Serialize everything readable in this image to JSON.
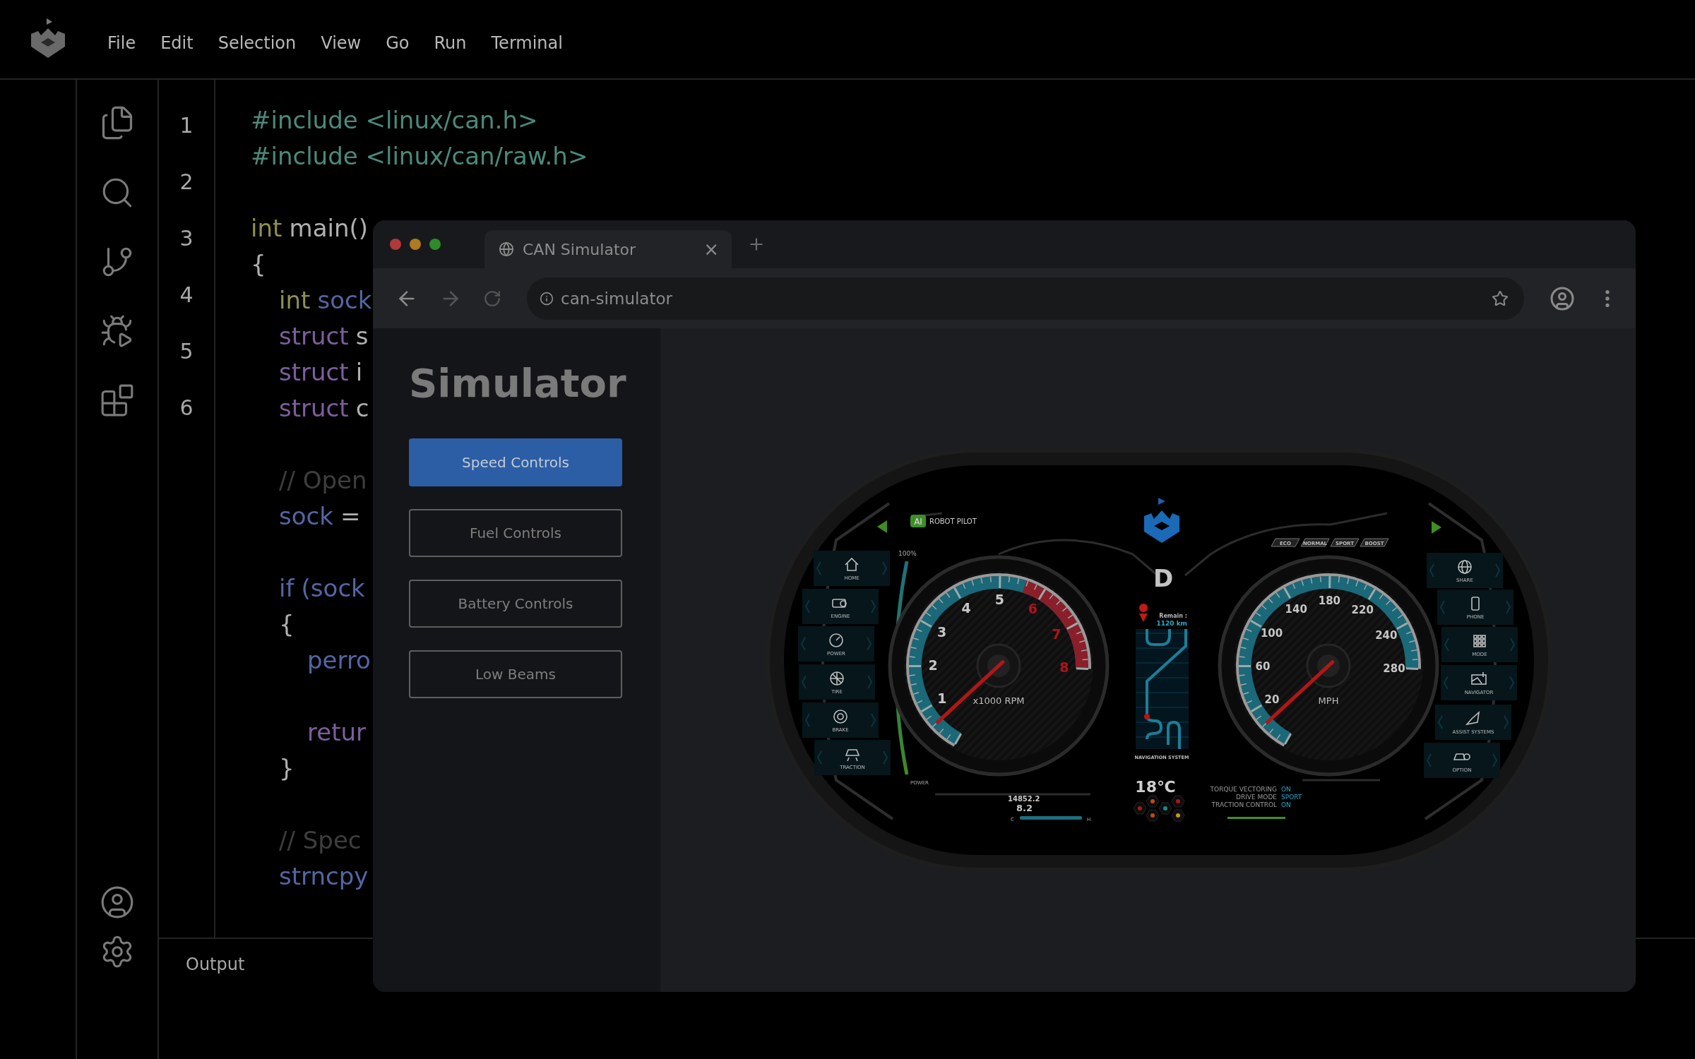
{
  "menu_bar": {
    "items": [
      "File",
      "Edit",
      "Selection",
      "View",
      "Go",
      "Run",
      "Terminal"
    ]
  },
  "editor": {
    "line_numbers": [
      "1",
      "2",
      "3",
      "4",
      "5",
      "6"
    ],
    "lines": [
      {
        "kind": "code",
        "tokens": [
          {
            "text": "#include <linux/can.h>",
            "kind": "preproc"
          }
        ]
      },
      {
        "kind": "code",
        "tokens": [
          {
            "text": "#include <linux/can/raw.h>",
            "kind": "preproc"
          }
        ]
      },
      {
        "kind": "blank"
      },
      {
        "kind": "code",
        "tokens": [
          {
            "text": "int",
            "kind": "type"
          },
          {
            "text": "main()",
            "kind": "plain"
          }
        ]
      },
      {
        "kind": "code",
        "tokens": [
          {
            "text": "{",
            "kind": "plain"
          }
        ],
        "children": [
          {
            "kind": "code",
            "tokens": [
              {
                "text": "int",
                "kind": "type"
              },
              {
                "text": "sock",
                "kind": "ident"
              }
            ]
          },
          {
            "kind": "code",
            "tokens": [
              {
                "text": "struct",
                "kind": "keyword"
              },
              {
                "text": "s",
                "kind": "plain"
              }
            ]
          },
          {
            "kind": "code",
            "tokens": [
              {
                "text": "struct",
                "kind": "keyword"
              },
              {
                "text": "i",
                "kind": "plain"
              }
            ]
          },
          {
            "kind": "code",
            "tokens": [
              {
                "text": "struct",
                "kind": "keyword"
              },
              {
                "text": "c",
                "kind": "plain"
              }
            ]
          },
          {
            "kind": "blank"
          },
          {
            "kind": "code",
            "tokens": [
              {
                "text": "// Open",
                "kind": "comment"
              }
            ]
          },
          {
            "kind": "code",
            "tokens": [
              {
                "text": "sock",
                "kind": "ident"
              },
              {
                "text": "=",
                "kind": "plain"
              }
            ]
          },
          {
            "kind": "blank"
          },
          {
            "kind": "code",
            "tokens": [
              {
                "text": "if",
                "kind": "ident"
              },
              {
                "text": "(sock",
                "kind": "ident"
              }
            ]
          },
          {
            "kind": "code",
            "tokens": [
              {
                "text": "{",
                "kind": "plain"
              }
            ],
            "children": [
              {
                "kind": "code",
                "tokens": [
                  {
                    "text": "perro",
                    "kind": "ident"
                  }
                ]
              },
              {
                "kind": "blank"
              },
              {
                "kind": "code",
                "tokens": [
                  {
                    "text": "retur",
                    "kind": "keyword"
                  }
                ]
              }
            ]
          },
          {
            "kind": "code",
            "tokens": [
              {
                "text": "}",
                "kind": "plain"
              }
            ]
          },
          {
            "kind": "blank"
          },
          {
            "kind": "code",
            "tokens": [
              {
                "text": "// Spec",
                "kind": "comment"
              }
            ]
          },
          {
            "kind": "code",
            "tokens": [
              {
                "text": "strncpy",
                "kind": "ident"
              }
            ]
          }
        ]
      }
    ]
  },
  "output_panel": {
    "title": "Output"
  },
  "browser": {
    "tab": {
      "title": "CAN Simulator",
      "close": "×"
    },
    "address": "can-simulator"
  },
  "sidebar": {
    "title": "Simulator",
    "buttons": [
      {
        "label": "Speed Controls",
        "selected": true
      },
      {
        "label": "Fuel Controls",
        "selected": false
      },
      {
        "label": "Battery Controls",
        "selected": false
      },
      {
        "label": "Low Beams",
        "selected": false
      }
    ]
  },
  "cluster": {
    "autopilot": {
      "badge": "AI",
      "label": "ROBOT PILOT"
    },
    "left_menu": [
      {
        "label": "HOME"
      },
      {
        "label": "ENGINE"
      },
      {
        "label": "POWER"
      },
      {
        "label": "TIRE"
      },
      {
        "label": "BRAKE"
      },
      {
        "label": "TRACTION"
      }
    ],
    "right_menu": [
      {
        "label": "SHARE"
      },
      {
        "label": "PHONE"
      },
      {
        "label": "MODE"
      },
      {
        "label": "NAVIGATOR"
      },
      {
        "label": "ASSIST SYSTEMS"
      },
      {
        "label": "OPTION"
      }
    ],
    "gauges": [
      {
        "kind": "rpm",
        "unit": "x1000 RPM",
        "labels": [
          {
            "text": "1",
            "warning": false
          },
          {
            "text": "2",
            "warning": false
          },
          {
            "text": "3",
            "warning": false
          },
          {
            "text": "4",
            "warning": false
          },
          {
            "text": "5",
            "warning": false
          },
          {
            "text": "6",
            "warning": true
          },
          {
            "text": "7",
            "warning": true
          },
          {
            "text": "8",
            "warning": true
          }
        ]
      },
      {
        "kind": "speed",
        "unit": "MPH",
        "labels": [
          {
            "text": "20",
            "warning": false
          },
          {
            "text": "60",
            "warning": false
          },
          {
            "text": "100",
            "warning": false
          },
          {
            "text": "140",
            "warning": false
          },
          {
            "text": "180",
            "warning": false
          },
          {
            "text": "220",
            "warning": false
          },
          {
            "text": "240",
            "warning": false
          },
          {
            "text": "280",
            "warning": false
          }
        ]
      }
    ],
    "gear": "D",
    "navigation": {
      "remain_label": "Remain :",
      "remain_value": "1120 km",
      "title": "NAVIGATION SYSTEM"
    },
    "temperature": "18℃",
    "drive_modes": [
      "ECO",
      "NORMAL",
      "SPORT",
      "BOOST"
    ],
    "power_meter": {
      "top_label": "100%",
      "label": "POWER"
    },
    "odometer": {
      "total": "14852.2",
      "average": "8.2",
      "cold": "C",
      "hot": "H"
    },
    "status": [
      {
        "label": "TORQUE VECTORING",
        "value": "ON"
      },
      {
        "label": "DRIVE MODE",
        "value": "SPORT"
      },
      {
        "label": "TRACTION CONTROL",
        "value": "ON"
      }
    ]
  }
}
